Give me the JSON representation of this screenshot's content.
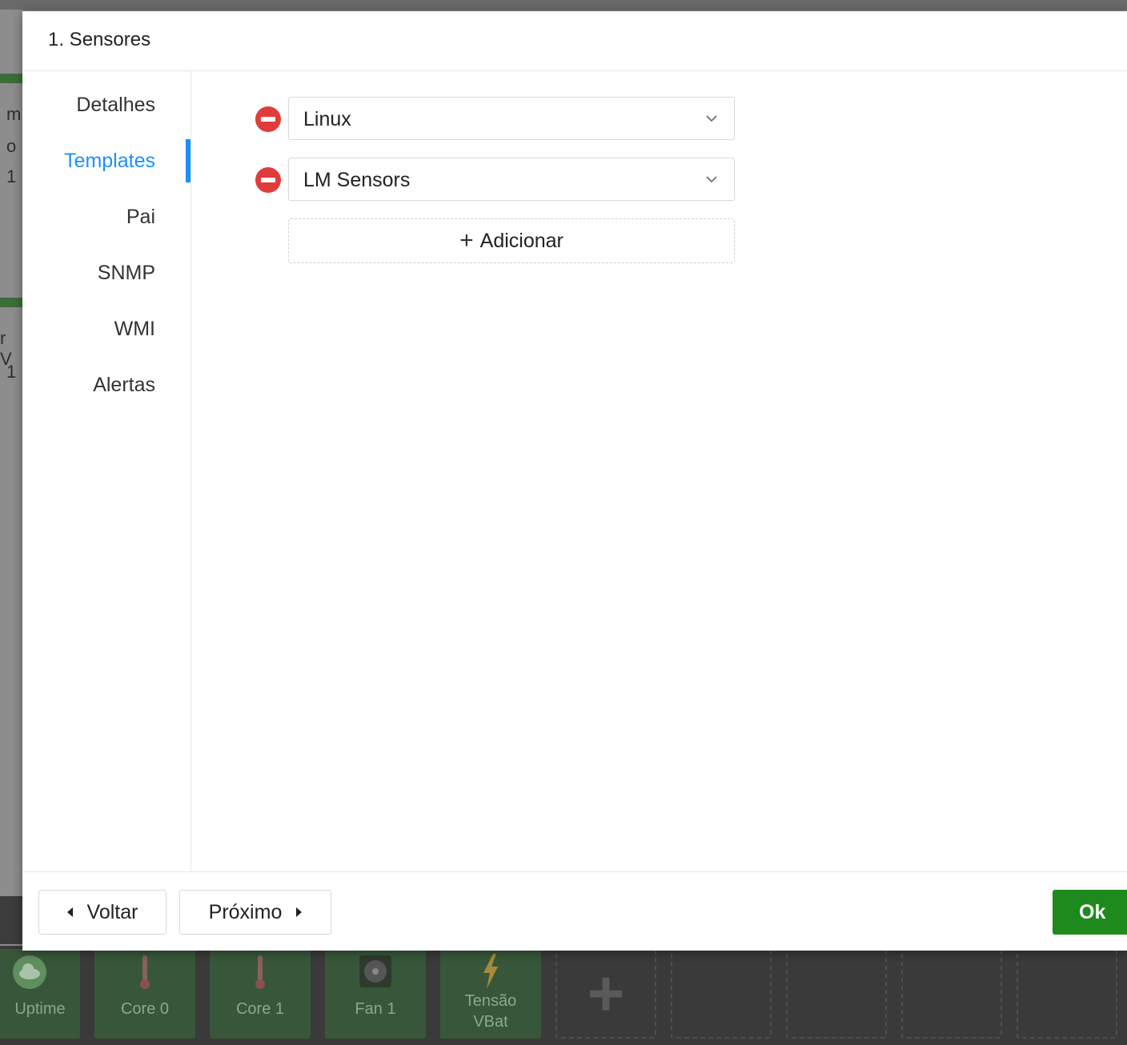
{
  "dialog": {
    "title": "1. Sensores",
    "nav": [
      {
        "label": "Detalhes",
        "active": false
      },
      {
        "label": "Templates",
        "active": true
      },
      {
        "label": "Pai",
        "active": false
      },
      {
        "label": "SNMP",
        "active": false
      },
      {
        "label": "WMI",
        "active": false
      },
      {
        "label": "Alertas",
        "active": false
      }
    ],
    "templates": [
      {
        "value": "Linux"
      },
      {
        "value": "LM Sensors"
      }
    ],
    "add_label": "Adicionar",
    "footer": {
      "back_label": "Voltar",
      "next_label": "Próximo",
      "ok_label": "Ok"
    }
  },
  "background": {
    "left_fragments": [
      "m",
      "o",
      "1",
      "r V",
      "1"
    ],
    "tiles": [
      {
        "label": "Uptime",
        "icon": "cloud-icon"
      },
      {
        "label": "Core 0",
        "icon": "thermometer-icon"
      },
      {
        "label": "Core 1",
        "icon": "thermometer-icon"
      },
      {
        "label": "Fan 1",
        "icon": "fan-icon"
      },
      {
        "label": "Tensão VBat",
        "icon": "lightning-icon"
      }
    ]
  },
  "colors": {
    "accent": "#1a90ff",
    "ok_button": "#1e8a1e",
    "remove_icon": "#e03c3c"
  }
}
